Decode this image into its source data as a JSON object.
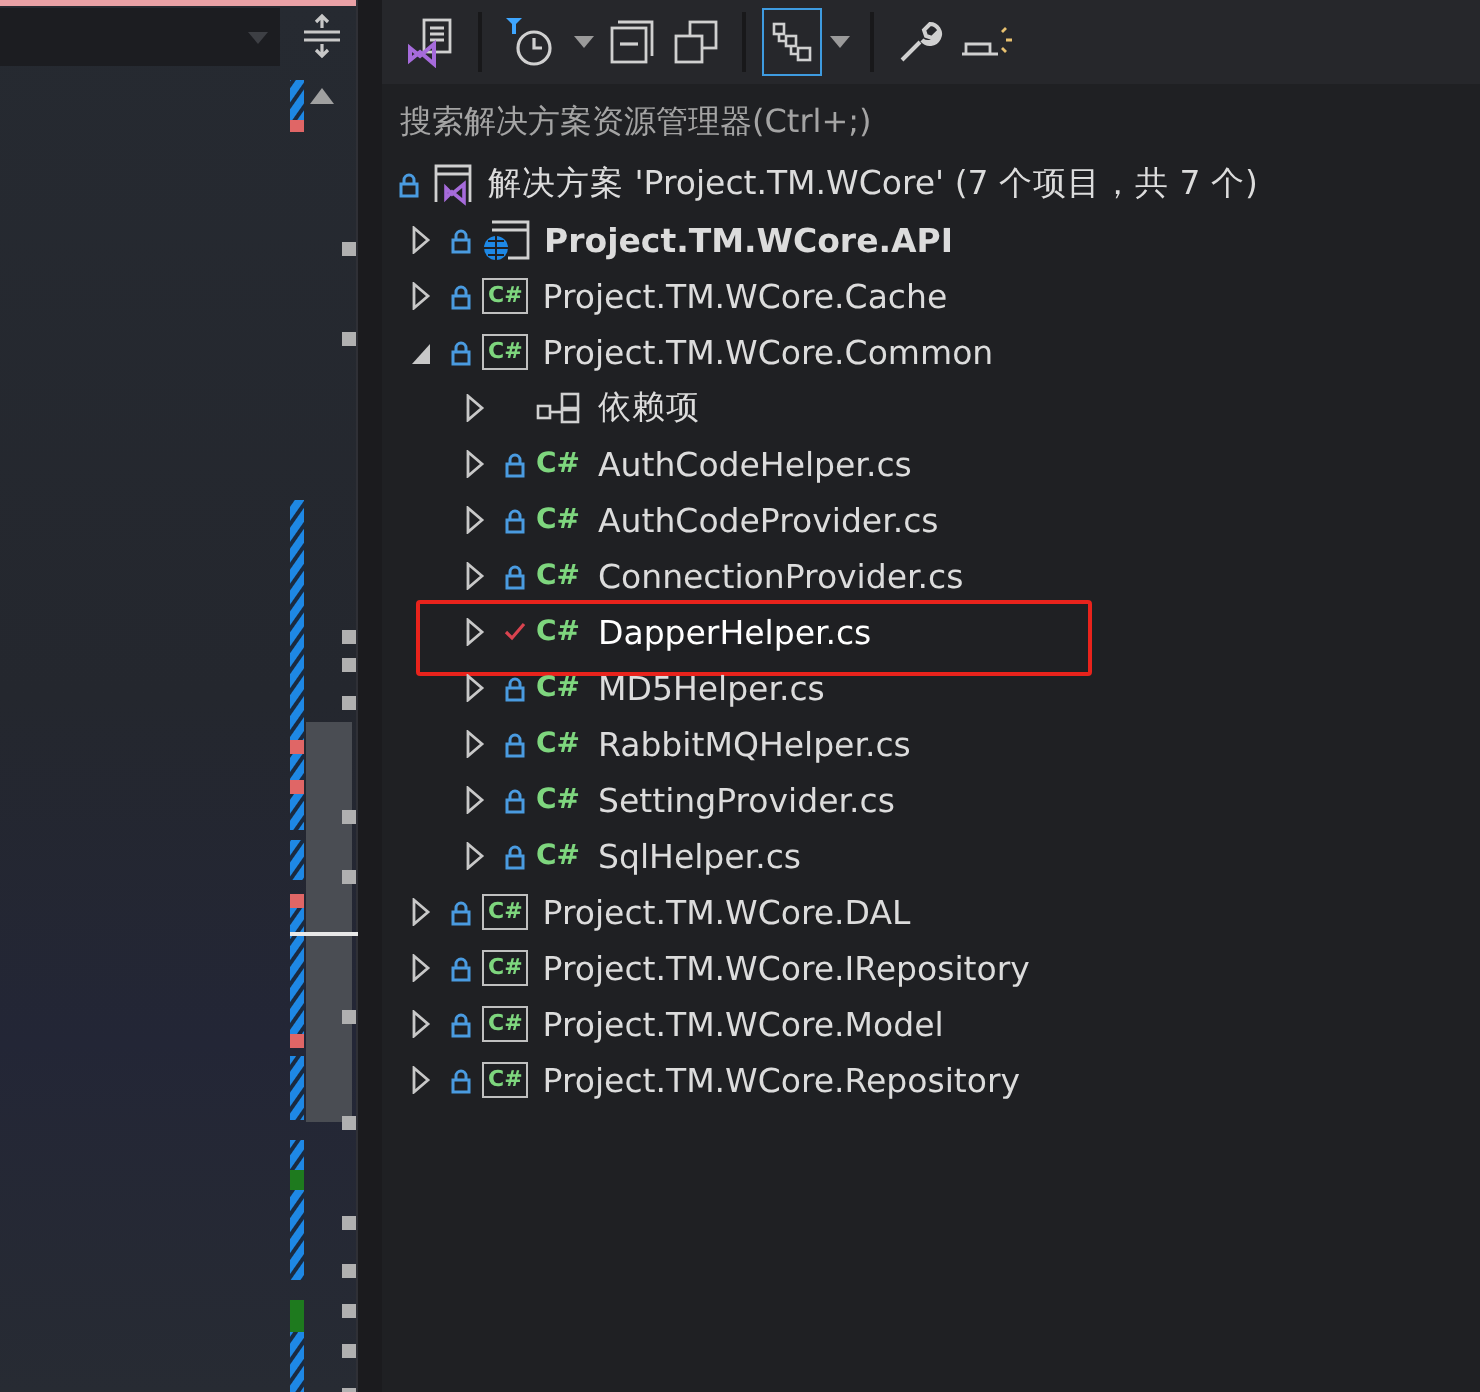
{
  "toolbar": [
    {
      "kind": "views"
    },
    {
      "kind": "separator"
    },
    {
      "kind": "history"
    },
    {
      "kind": "caret"
    },
    {
      "kind": "collapse"
    },
    {
      "kind": "copies"
    },
    {
      "kind": "separator"
    },
    {
      "kind": "tree",
      "selected": true
    },
    {
      "kind": "caret"
    },
    {
      "kind": "separator"
    },
    {
      "kind": "wrench"
    },
    {
      "kind": "preview"
    }
  ],
  "search": {
    "placeholder": "搜索解决方案资源管理器(Ctrl+;)"
  },
  "tree": [
    {
      "kind": "solution",
      "label": "解决方案 'Project.TM.WCore' (7 个项目，共 7 个)",
      "locked": true,
      "children": [
        {
          "kind": "web-project",
          "label": "Project.TM.WCore.API",
          "bold": true,
          "locked": true,
          "expanded": false
        },
        {
          "kind": "project",
          "icon_text": "C#",
          "label": "Project.TM.WCore.Cache",
          "locked": true,
          "expanded": false
        },
        {
          "kind": "project",
          "icon_text": "C#",
          "label": "Project.TM.WCore.Common",
          "locked": true,
          "expanded": true,
          "children": [
            {
              "kind": "dependencies",
              "label": "依赖项",
              "expanded": false
            },
            {
              "kind": "file",
              "icon_text": "C#",
              "label": "AuthCodeHelper.cs",
              "locked": true,
              "expanded": false
            },
            {
              "kind": "file",
              "icon_text": "C#",
              "label": "AuthCodeProvider.cs",
              "locked": true,
              "expanded": false
            },
            {
              "kind": "file",
              "icon_text": "C#",
              "label": "ConnectionProvider.cs",
              "locked": true,
              "expanded": false
            },
            {
              "kind": "file",
              "icon_text": "C#",
              "label": "DapperHelper.cs",
              "locked": false,
              "edited": true,
              "expanded": false,
              "highlighted": true
            },
            {
              "kind": "file",
              "icon_text": "C#",
              "label": "MD5Helper.cs",
              "locked": true,
              "expanded": false
            },
            {
              "kind": "file",
              "icon_text": "C#",
              "label": "RabbitMQHelper.cs",
              "locked": true,
              "expanded": false
            },
            {
              "kind": "file",
              "icon_text": "C#",
              "label": "SettingProvider.cs",
              "locked": true,
              "expanded": false
            },
            {
              "kind": "file",
              "icon_text": "C#",
              "label": "SqlHelper.cs",
              "locked": true,
              "expanded": false
            }
          ]
        },
        {
          "kind": "project",
          "icon_text": "C#",
          "label": "Project.TM.WCore.DAL",
          "locked": true,
          "expanded": false
        },
        {
          "kind": "project",
          "icon_text": "C#",
          "label": "Project.TM.WCore.IRepository",
          "locked": true,
          "expanded": false
        },
        {
          "kind": "project",
          "icon_text": "C#",
          "label": "Project.TM.WCore.Model",
          "locked": true,
          "expanded": false
        },
        {
          "kind": "project",
          "icon_text": "C#",
          "label": "Project.TM.WCore.Repository",
          "locked": true,
          "expanded": false
        }
      ]
    }
  ]
}
